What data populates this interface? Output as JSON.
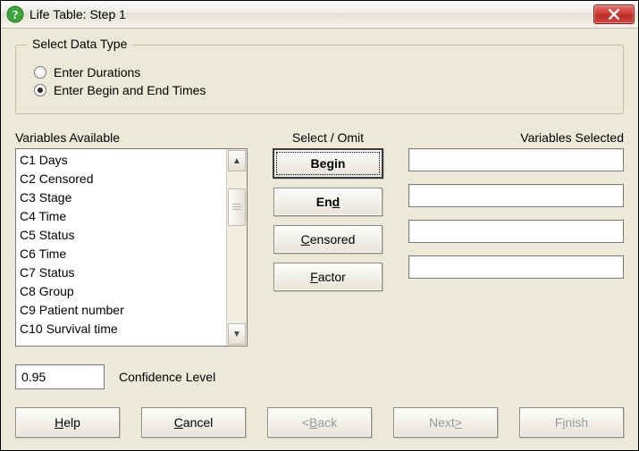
{
  "window": {
    "title": "Life Table: Step 1"
  },
  "groupbox": {
    "legend": "Select Data Type",
    "option1": "Enter Durations",
    "option2": "Enter Begin and End Times",
    "selected_index": 1
  },
  "labels": {
    "available": "Variables Available",
    "select_omit": "Select / Omit",
    "selected": "Variables Selected",
    "confidence": "Confidence Level"
  },
  "variables_available": [
    "C1 Days",
    "C2 Censored",
    "C3 Stage",
    "C4 Time",
    "C5 Status",
    "C6 Time",
    "C7 Status",
    "C8 Group",
    "C9 Patient number",
    "C10 Survival time"
  ],
  "select_buttons": {
    "begin_pre": "Be",
    "begin_ul": "g",
    "begin_post": "in",
    "end_pre": "En",
    "end_ul": "d",
    "end_post": "",
    "censored_pre": "",
    "censored_ul": "C",
    "censored_post": "ensored",
    "factor_pre": "",
    "factor_ul": "F",
    "factor_post": "actor"
  },
  "variables_selected": {
    "begin": "",
    "end": "",
    "censored": "",
    "factor": ""
  },
  "confidence_level": "0.95",
  "buttons": {
    "help_pre": "",
    "help_ul": "H",
    "help_post": "elp",
    "cancel_pre": "",
    "cancel_ul": "C",
    "cancel_post": "ancel",
    "back_prefix": "< ",
    "back_ul": "B",
    "back_post": "ack",
    "next_pre": "Next ",
    "next_ul": ">",
    "next_post": "",
    "finish_pre": "F",
    "finish_ul": "i",
    "finish_post": "nish"
  },
  "icons": {
    "close": "close-icon",
    "help": "help-icon",
    "scroll_up": "▲",
    "scroll_down": "▼"
  }
}
